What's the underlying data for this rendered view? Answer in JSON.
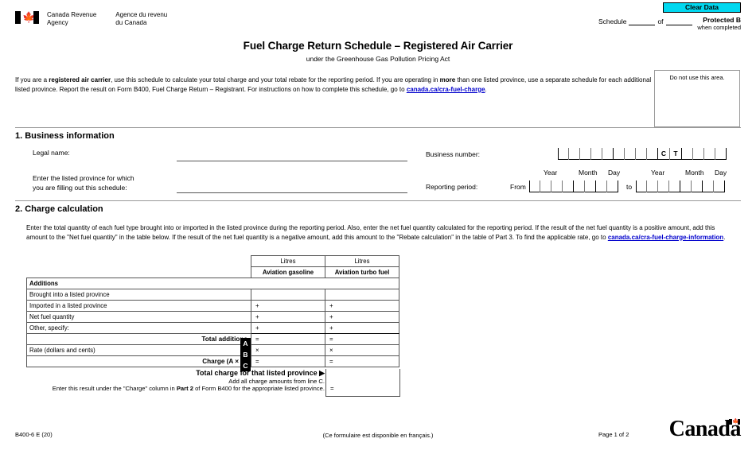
{
  "header": {
    "agency_en": "Canada Revenue\nAgency",
    "agency_fr": "Agence du revenu\ndu Canada",
    "clear_button": "Clear Data",
    "schedule_label": "Schedule",
    "of_label": "of",
    "protected_b": "Protected B",
    "when_completed": "when completed",
    "title": "Fuel Charge Return Schedule – Registered Air Carrier",
    "subtitle": "under the Greenhouse Gas Pollution Pricing Act",
    "accent_color": "#00d8f0"
  },
  "intro": {
    "part1": "If you are a ",
    "bold1": "registered air carrier",
    "part2": ", use this schedule to calculate your total charge and your total rebate for the reporting period. If you are operating in ",
    "bold2": "more",
    "part3": " than one listed province, use a separate schedule for each additional listed province. Report the result on Form B400, Fuel Charge Return – Registrant. For instructions on how to complete this schedule, go to ",
    "link": "canada.ca/cra-fuel-charge",
    "part4": ".",
    "do_not_use": "Do not use this area."
  },
  "section1": {
    "heading": "1. Business information",
    "legal_name_label": "Legal name:",
    "province_label": "Enter the listed province for which\nyou are filling out this schedule:",
    "business_number_label": "Business number:",
    "reporting_period_label": "Reporting period:",
    "from_label": "From",
    "to_label": "to",
    "bn_program_letters": [
      "C",
      "T"
    ],
    "bn_digit_cells": 9,
    "bn_suffix_cells": 4,
    "date_labels": {
      "year": "Year",
      "month": "Month",
      "day": "Day"
    },
    "date_cells": {
      "year": 4,
      "month": 2,
      "day": 2
    }
  },
  "section2": {
    "heading": "2. Charge calculation",
    "para1": "Enter the total quantity of each fuel type brought into or imported in the listed province during the reporting period. Also, enter the net fuel quantity calculated for the reporting period. If the result of the net fuel",
    "para2": "quantity is a positive amount, add this amount to the \"Net fuel quantity\" in the table below. If the result of the net fuel quantity is a negative amount, add this amount to the \"Rebate calculation\" in the table of",
    "para3_pre": "Part 3. To find the applicable rate, go to ",
    "para3_link": "canada.ca/cra-fuel-charge-information",
    "para3_post": "."
  },
  "table": {
    "unit_header": "Litres",
    "columns": [
      "Aviation gasoline",
      "Aviation turbo fuel"
    ],
    "section_label": "Additions",
    "rows": [
      {
        "label": "Brought into a listed province",
        "op": "",
        "op2": ""
      },
      {
        "label": "Imported in a listed province",
        "op": "+",
        "op2": "+"
      },
      {
        "label": "Net fuel quantity",
        "op": "+",
        "op2": "+"
      },
      {
        "label": "Other, specify:",
        "op": "+",
        "op2": "+"
      }
    ],
    "total_additions": {
      "label": "Total additions",
      "letter": "A",
      "op": "=",
      "op2": "="
    },
    "rate": {
      "label": "Rate (dollars and cents)",
      "letter": "B",
      "op": "×",
      "op2": "×"
    },
    "charge": {
      "label": "Charge (A ×  B)",
      "letter": "C",
      "op": "=",
      "op2": "="
    },
    "total_charge": {
      "line1": "Total charge for that listed province  ▶",
      "line2": "Add all charge amounts from line C.",
      "line3_pre": "Enter this result under the \"Charge\" column in ",
      "line3_bold": "Part 2",
      "line3_post": " of Form B400 for the appropriate listed province.",
      "op": "="
    }
  },
  "footer": {
    "form_code": "B400-6 E (20)",
    "french_note": "(Ce formulaire est disponible en français.)",
    "page": "Page 1 of 2",
    "wordmark": "Canada"
  }
}
